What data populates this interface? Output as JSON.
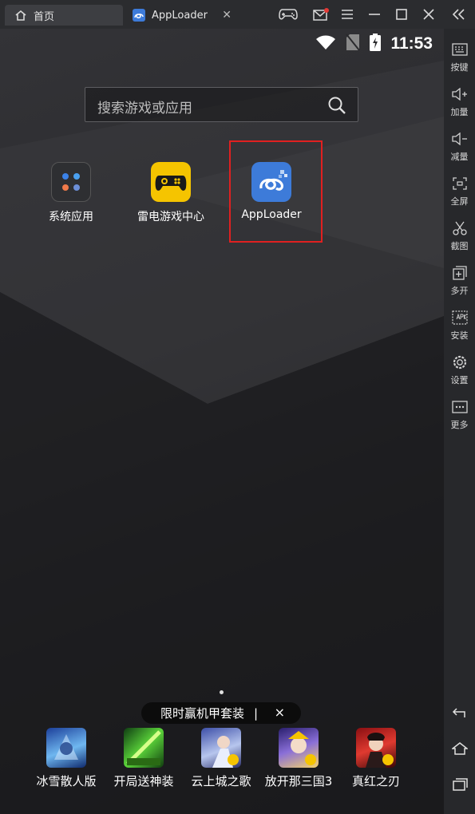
{
  "titlebar": {
    "tabs": [
      {
        "label": "首页",
        "icon": "home-icon"
      },
      {
        "label": "AppLoader",
        "icon": "apploader-tab-icon"
      }
    ],
    "controls": [
      "gamepad-icon",
      "mail-icon",
      "menu-icon",
      "minimize-icon",
      "maximize-icon",
      "close-icon",
      "collapse-icon"
    ]
  },
  "statusbar": {
    "time": "11:53"
  },
  "search": {
    "placeholder": "搜索游戏或应用"
  },
  "home_apps": [
    {
      "label": "系统应用",
      "icon": "system-apps-folder-icon"
    },
    {
      "label": "雷电游戏中心",
      "icon": "ld-game-center-icon"
    },
    {
      "label": "AppLoader",
      "icon": "apploader-icon"
    }
  ],
  "promo": {
    "text": "限时赢机甲套装",
    "separator": "|",
    "close": "×"
  },
  "dock": [
    {
      "label": "冰雪散人版"
    },
    {
      "label": "开局送神装"
    },
    {
      "label": "云上城之歌"
    },
    {
      "label": "放开那三国3"
    },
    {
      "label": "真红之刃"
    }
  ],
  "sidebar": {
    "items": [
      {
        "label": "按键",
        "icon": "keyboard-icon"
      },
      {
        "label": "加量",
        "icon": "volume-up-icon"
      },
      {
        "label": "减量",
        "icon": "volume-down-icon"
      },
      {
        "label": "全屏",
        "icon": "fullscreen-icon"
      },
      {
        "label": "截图",
        "icon": "scissors-icon"
      },
      {
        "label": "多开",
        "icon": "multi-instance-icon"
      },
      {
        "label": "安装",
        "icon": "apk-install-icon"
      },
      {
        "label": "设置",
        "icon": "gear-icon"
      },
      {
        "label": "更多",
        "icon": "more-icon"
      }
    ],
    "nav": [
      "back-icon",
      "home-icon",
      "recent-apps-icon"
    ]
  },
  "colors": {
    "highlight": "#e02020",
    "apploader_blue": "#3d7bd9",
    "ld_yellow": "#f5c400"
  }
}
